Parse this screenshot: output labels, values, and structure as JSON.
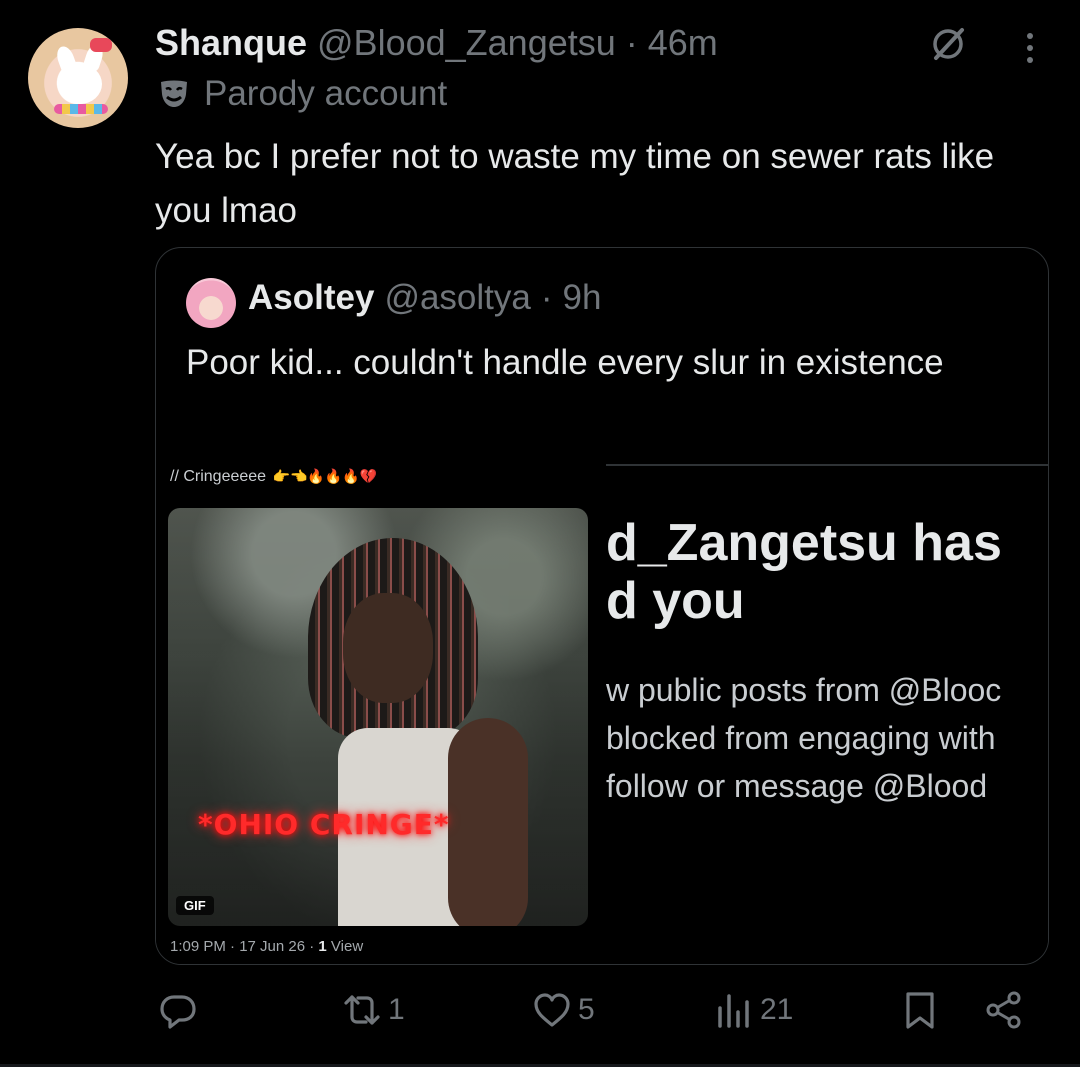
{
  "tweet": {
    "author_name": "Shanque",
    "author_handle": "@Blood_Zangetsu",
    "separator": "·",
    "time": "46m",
    "label": "Parody account",
    "text": "Yea bc I prefer not to waste my time on sewer rats like you lmao"
  },
  "quote": {
    "author_name": "Asoltey",
    "author_handle": "@asoltya",
    "separator": "·",
    "time": "9h",
    "text": "Poor kid... couldn't handle every slur in existence",
    "image": {
      "caption": "// Cringeeeee",
      "caption_emojis": "👉👈🔥🔥🔥💔",
      "gif_overlay_text": "*OHIO CRINGE*",
      "gif_badge": "GIF",
      "blocked_title_1": "d_Zangetsu has",
      "blocked_title_2": "d you",
      "blocked_line_1": "w public posts from @Blooc",
      "blocked_line_2": "blocked from engaging with",
      "blocked_line_3": "follow or message @Blood",
      "meta_time": "1:09 PM · 17 Jun 26 · ",
      "meta_views_count": "1",
      "meta_views_label": " View"
    }
  },
  "actions": {
    "reply_count": "",
    "repost_count": "1",
    "like_count": "5",
    "views_count": "21"
  },
  "colors": {
    "background": "#000000",
    "text_primary": "#e7e9ea",
    "text_secondary": "#71767b",
    "border": "#2f3336",
    "gif_text": "#ff2a2a"
  },
  "icons": [
    "grok-icon",
    "more-icon",
    "parody-mask-icon",
    "reply-icon",
    "repost-icon",
    "like-icon",
    "views-icon",
    "bookmark-icon",
    "share-icon"
  ]
}
